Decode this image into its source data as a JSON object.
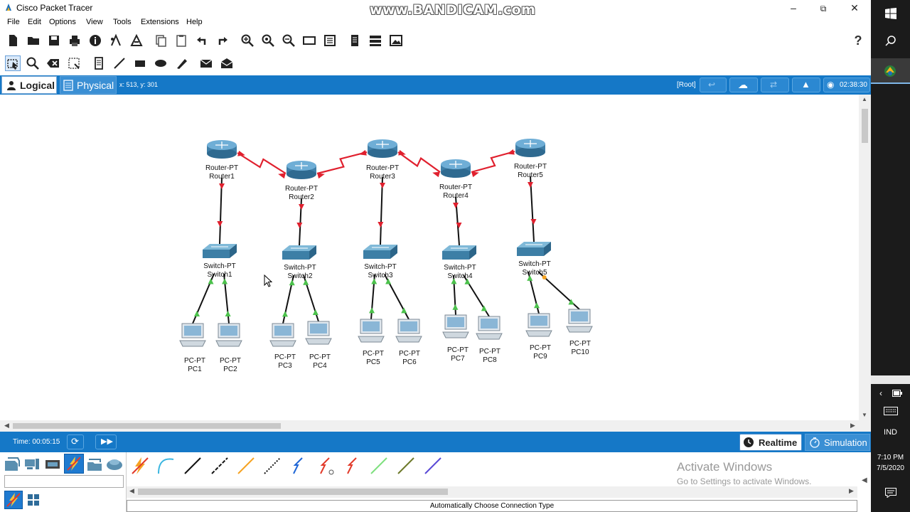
{
  "window": {
    "title": "Cisco Packet Tracer",
    "watermark": "www.BANDICAM.com",
    "minimize_icon": "minimize-icon",
    "restore_icon": "restore-icon",
    "close_icon": "close-icon"
  },
  "menu": [
    "File",
    "Edit",
    "Options",
    "View",
    "Tools",
    "Extensions",
    "Help"
  ],
  "workspace": {
    "tab_logical": "Logical",
    "tab_physical": "Physical",
    "coords": "x: 513, y: 301",
    "root": "[Root]",
    "clock": "02:38:30"
  },
  "devices": {
    "routers": [
      {
        "type": "Router-PT",
        "name": "Router1"
      },
      {
        "type": "Router-PT",
        "name": "Router2"
      },
      {
        "type": "Router-PT",
        "name": "Router3"
      },
      {
        "type": "Router-PT",
        "name": "Router4"
      },
      {
        "type": "Router-PT",
        "name": "Router5"
      }
    ],
    "switches": [
      {
        "type": "Switch-PT",
        "name": "Switch1"
      },
      {
        "type": "Switch-PT",
        "name": "Switch2"
      },
      {
        "type": "Switch-PT",
        "name": "Switch3"
      },
      {
        "type": "Switch-PT",
        "name": "Switch4"
      },
      {
        "type": "Switch-PT",
        "name": "Switch5"
      }
    ],
    "pcs": [
      {
        "type": "PC-PT",
        "name": "PC1"
      },
      {
        "type": "PC-PT",
        "name": "PC2"
      },
      {
        "type": "PC-PT",
        "name": "PC3"
      },
      {
        "type": "PC-PT",
        "name": "PC4"
      },
      {
        "type": "PC-PT",
        "name": "PC5"
      },
      {
        "type": "PC-PT",
        "name": "PC6"
      },
      {
        "type": "PC-PT",
        "name": "PC7"
      },
      {
        "type": "PC-PT",
        "name": "PC8"
      },
      {
        "type": "PC-PT",
        "name": "PC9"
      },
      {
        "type": "PC-PT",
        "name": "PC10"
      }
    ]
  },
  "bottom": {
    "time": "Time: 00:05:15",
    "realtime": "Realtime",
    "simulation": "Simulation"
  },
  "palette": {
    "activate_title": "Activate Windows",
    "activate_sub": "Go to Settings to activate Windows.",
    "status": "Automatically Choose Connection Type"
  },
  "taskbar": {
    "lang": "IND",
    "time": "7:10 PM",
    "date": "7/5/2020"
  },
  "colors": {
    "accent_blue": "#1578c7",
    "serial_link": "#e0202e",
    "link_up": "#4cc24c"
  }
}
